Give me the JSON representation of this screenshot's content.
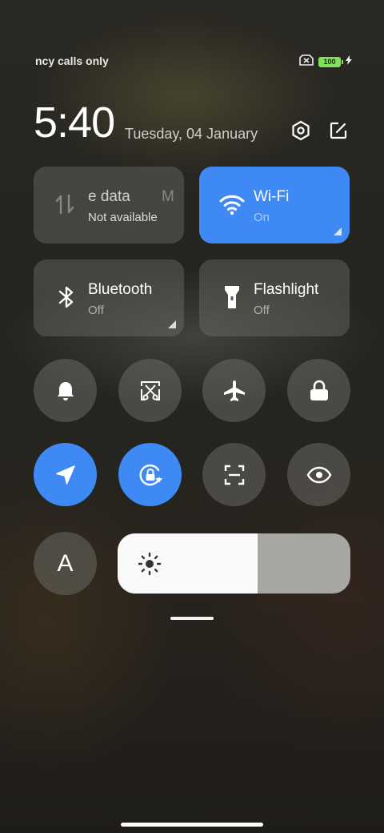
{
  "status_bar": {
    "carrier_text": "ncy calls only",
    "battery_level": "100"
  },
  "header": {
    "time": "5:40",
    "date": "Tuesday, 04 January"
  },
  "tiles": [
    {
      "label": "e data",
      "label_extra": "M",
      "sub": "Not available",
      "icon": "mobile-data-icon",
      "active": false
    },
    {
      "label": "Wi-Fi",
      "sub": "On",
      "icon": "wifi-icon",
      "active": true
    },
    {
      "label": "Bluetooth",
      "sub": "Off",
      "icon": "bluetooth-icon",
      "active": false
    },
    {
      "label": "Flashlight",
      "sub": "Off",
      "icon": "flashlight-icon",
      "active": false
    }
  ],
  "toggles": [
    {
      "name": "notifications",
      "icon": "bell-icon",
      "active": false
    },
    {
      "name": "screenshot",
      "icon": "scissors-icon",
      "active": false
    },
    {
      "name": "airplane-mode",
      "icon": "airplane-icon",
      "active": false
    },
    {
      "name": "lock-screen",
      "icon": "lock-icon",
      "active": false
    },
    {
      "name": "location",
      "icon": "location-arrow-icon",
      "active": true
    },
    {
      "name": "rotation-lock",
      "icon": "rotation-lock-icon",
      "active": true
    },
    {
      "name": "scanner",
      "icon": "scan-icon",
      "active": false
    },
    {
      "name": "reading-mode",
      "icon": "eye-icon",
      "active": false
    }
  ],
  "auto_brightness": {
    "label": "A",
    "active": false
  },
  "brightness": {
    "level": 0.6,
    "icon": "sun-icon"
  },
  "colors": {
    "accent": "#3f89f5",
    "battery": "#7ee05b"
  }
}
